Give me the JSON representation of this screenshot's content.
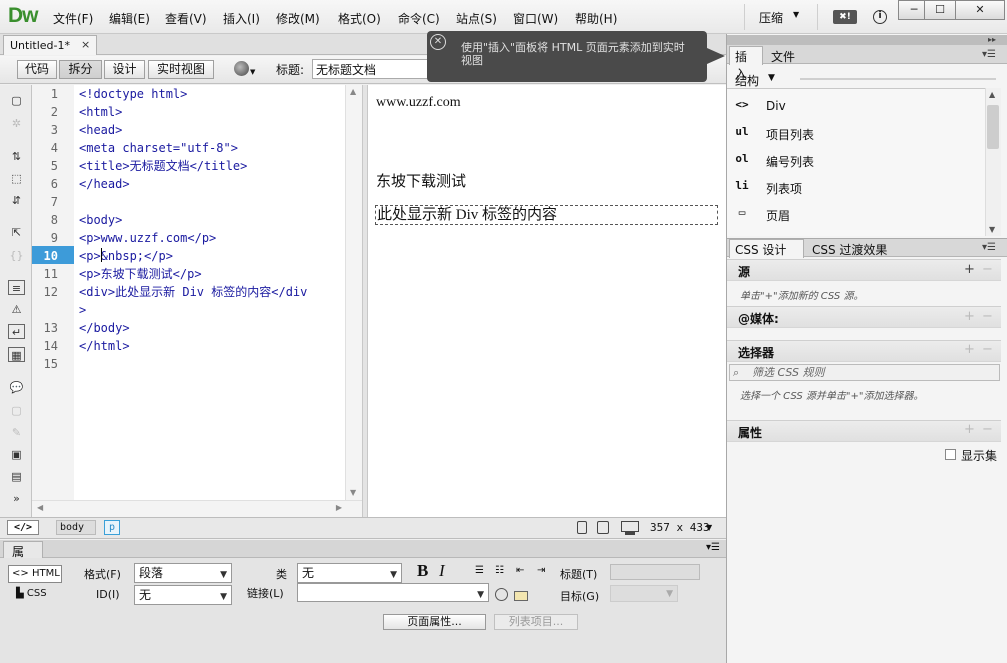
{
  "app": {
    "logo": "Dw"
  },
  "menus": [
    "文件(F)",
    "编辑(E)",
    "查看(V)",
    "插入(I)",
    "修改(M)",
    "格式(O)",
    "命令(C)",
    "站点(S)",
    "窗口(W)",
    "帮助(H)"
  ],
  "workspace": {
    "label": "压缩",
    "badge": "✖!"
  },
  "window_controls": {
    "minimize": "─",
    "maximize": "☐",
    "close": "✕"
  },
  "document": {
    "tab_title": "Untitled-1*",
    "close": "×"
  },
  "view_toolbar": {
    "code": "代码",
    "split": "拆分",
    "design": "设计",
    "live": "实时视图",
    "title_label": "标题:",
    "title_value": "无标题文档"
  },
  "tooltip": {
    "text": "使用\"插入\"面板将 HTML 页面元素添加到实时视图"
  },
  "code": {
    "line_numbers": [
      "1",
      "2",
      "3",
      "4",
      "5",
      "6",
      "7",
      "8",
      "9",
      "10",
      "11",
      "12",
      "",
      "13",
      "14",
      "15"
    ],
    "lines": [
      "<!doctype html>",
      "<html>",
      "<head>",
      "<meta charset=\"utf-8\">",
      "<title>无标题文档</title>",
      "</head>",
      "",
      "<body>",
      "<p>www.uzzf.com</p>",
      "<p>&nbsp;</p>",
      "<p>东坡下载测试</p>",
      "<div>此处显示新 Div 标签的内容</div",
      ">",
      "</body>",
      "</html>",
      ""
    ],
    "current_line": "10"
  },
  "design": {
    "line1": "www.uzzf.com",
    "line2": "东坡下载测试",
    "div_text": "此处显示新 Div 标签的内容"
  },
  "status": {
    "tag_btn": "</>",
    "crumbs": [
      "body",
      "p"
    ],
    "dimensions": "357 x 433"
  },
  "properties": {
    "tab": "属性",
    "html_btn": "HTML",
    "css_btn": "CSS",
    "format_label": "格式(F)",
    "format_value": "段落",
    "class_label": "类",
    "class_value": "无",
    "id_label": "ID(I)",
    "id_value": "无",
    "link_label": "链接(L)",
    "title_label": "标题(T)",
    "target_label": "目标(G)",
    "bold": "B",
    "italic": "I",
    "page_props": "页面属性...",
    "list_items": "列表项目..."
  },
  "insert_panel": {
    "tab_insert": "插入",
    "tab_files": "文件",
    "category": "结构",
    "items": [
      {
        "icon": "<>",
        "label": "Div"
      },
      {
        "icon": "ul",
        "label": "项目列表"
      },
      {
        "icon": "ol",
        "label": "编号列表"
      },
      {
        "icon": "li",
        "label": "列表项"
      },
      {
        "icon": "▭",
        "label": "页眉"
      }
    ]
  },
  "css_panel": {
    "tab_designer": "CSS 设计器",
    "tab_transitions": "CSS 过渡效果",
    "sources_label": "源",
    "sources_hint": "单击\"+\"添加新的 CSS 源。",
    "media_label": "@媒体:",
    "selectors_label": "选择器",
    "filter_placeholder": "筛选 CSS 规则",
    "selectors_hint": "选择一个 CSS 源并单击\"+\"添加选择器。",
    "properties_label": "属性",
    "show_set": "显示集"
  }
}
